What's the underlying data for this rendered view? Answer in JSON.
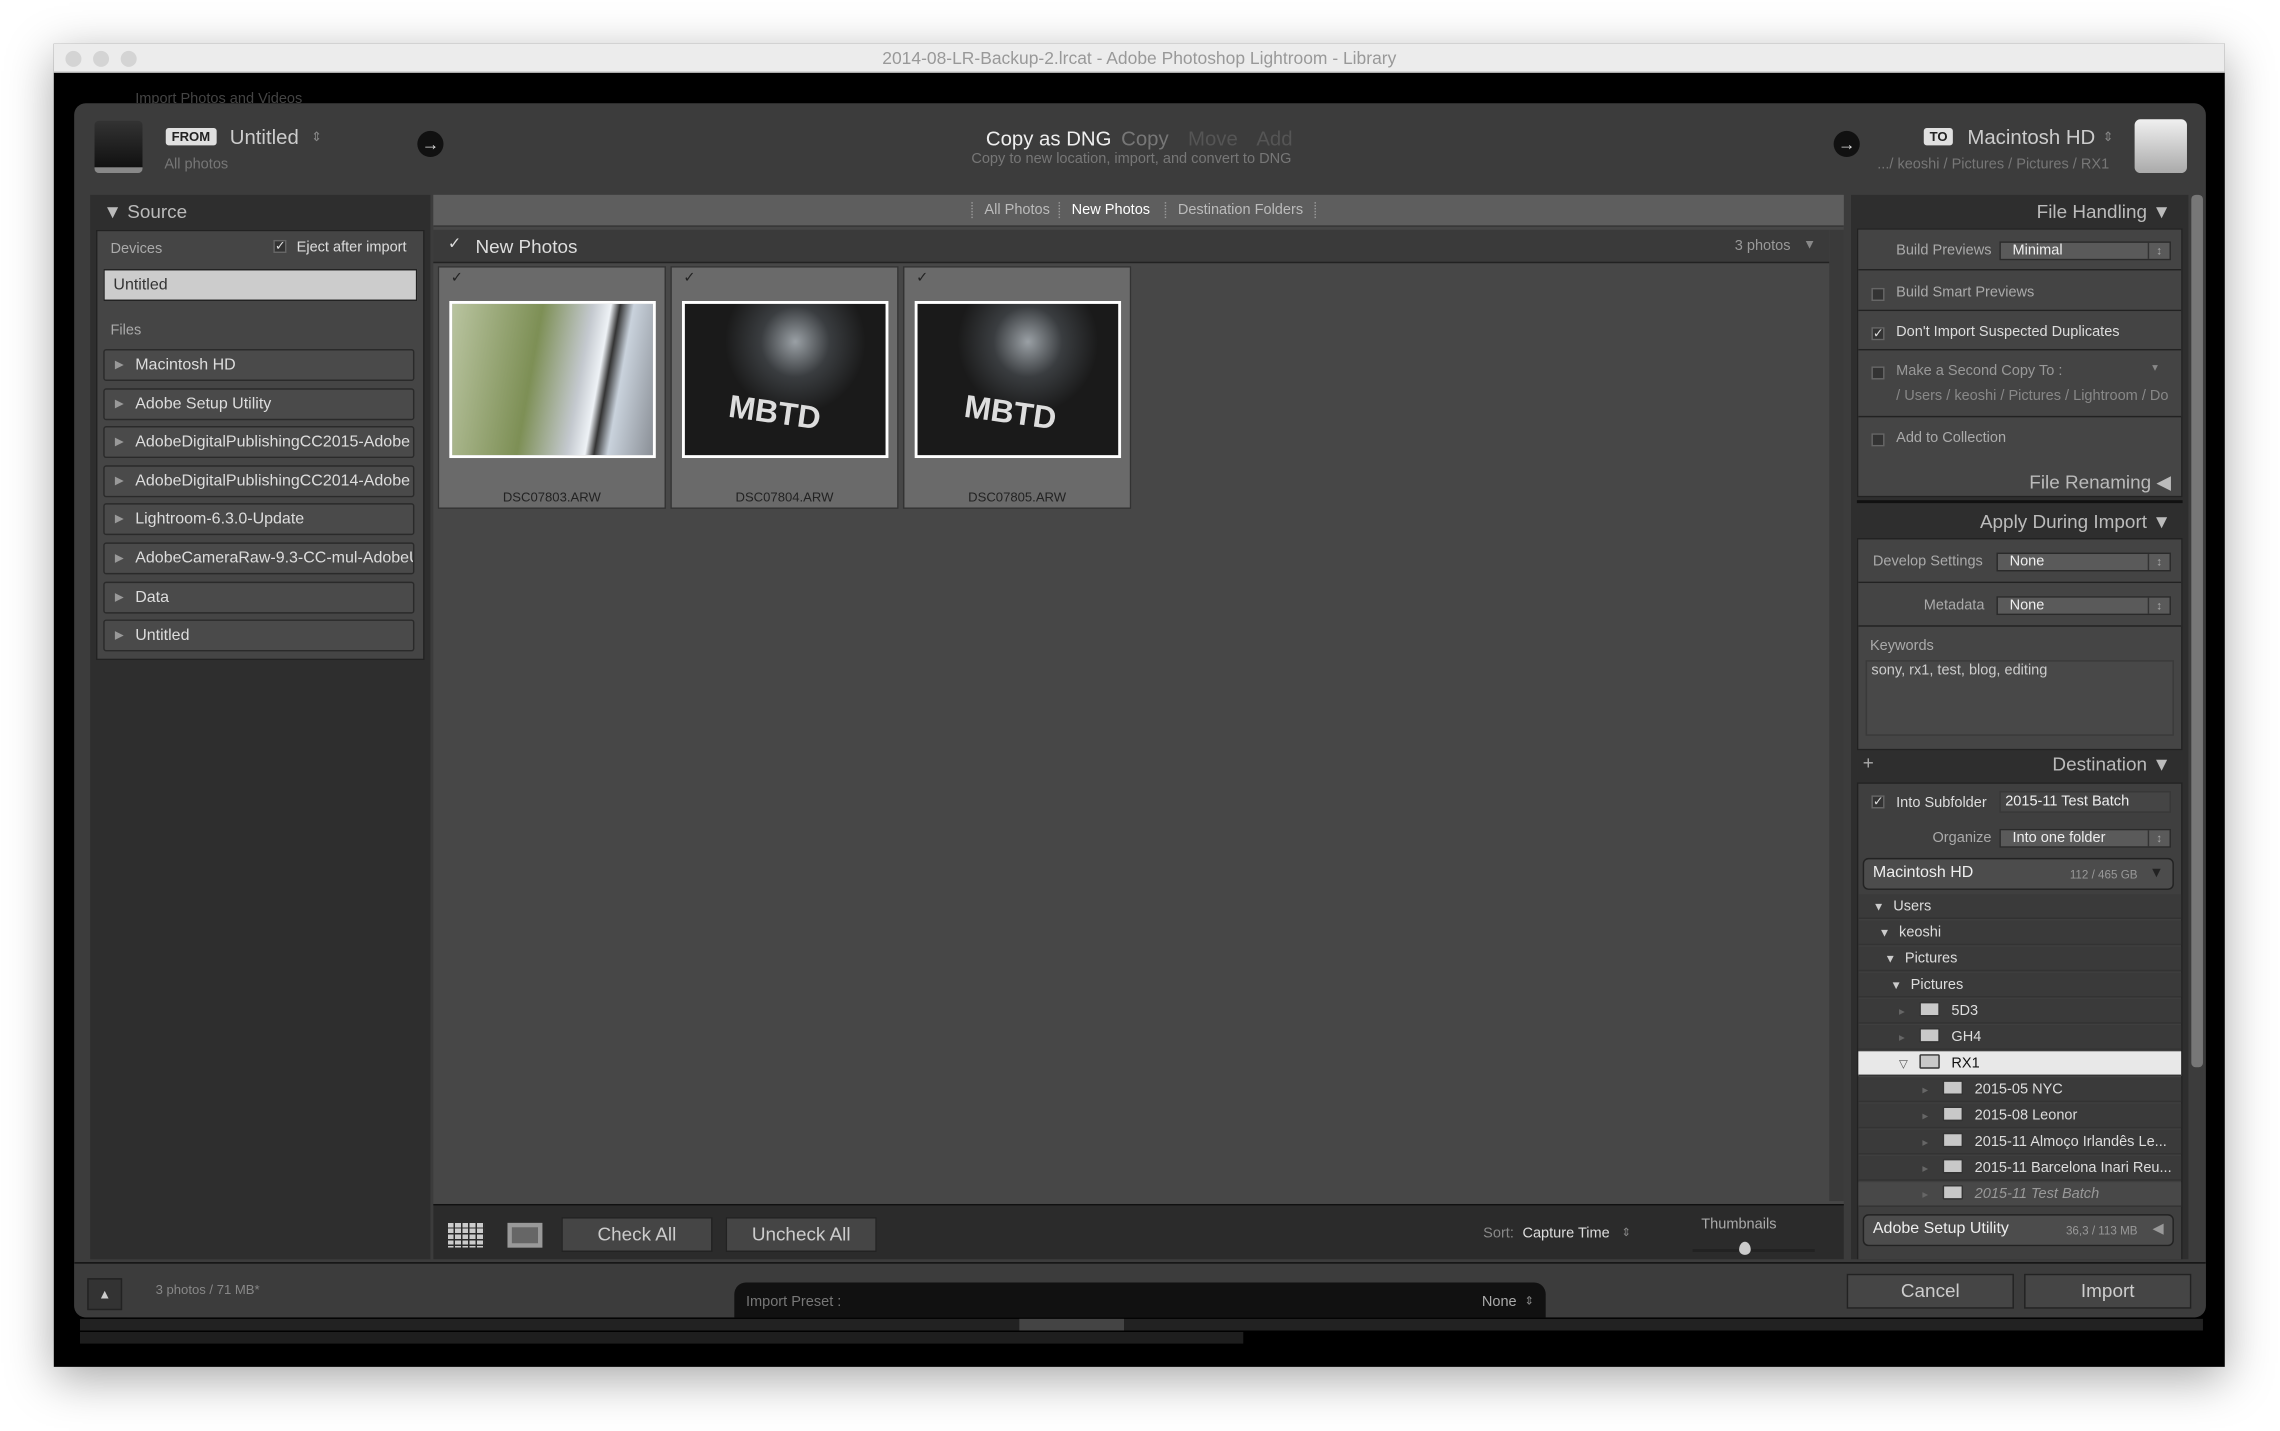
{
  "window": {
    "title": "2014-08-LR-Backup-2.lrcat - Adobe Photoshop Lightroom - Library",
    "behind_title": "Import Photos and Videos"
  },
  "header": {
    "from_badge": "FROM",
    "from_source": "Untitled",
    "from_sub": "All photos",
    "modes": [
      {
        "label": "Copy as DNG",
        "active": true
      },
      {
        "label": "Copy"
      },
      {
        "label": "Move"
      },
      {
        "label": "Add"
      }
    ],
    "mode_desc": "Copy to new location, import, and convert to DNG",
    "to_badge": "TO",
    "to_dest": "Macintosh HD",
    "to_path": ".../ keoshi / Pictures / Pictures / RX1"
  },
  "source": {
    "title": "Source",
    "devices_label": "Devices",
    "eject_label": "Eject after import",
    "eject_checked": true,
    "device": "Untitled",
    "files_label": "Files",
    "files": [
      "Macintosh HD",
      "Adobe Setup Utility",
      "AdobeDigitalPublishingCC2015-Adobe",
      "AdobeDigitalPublishingCC2014-Adobe",
      "Lightroom-6.3.0-Update",
      "AdobeCameraRaw-9.3-CC-mul-AdobeU",
      "Data",
      "Untitled"
    ]
  },
  "center": {
    "tabs": [
      "All Photos",
      "New Photos",
      "Destination Folders"
    ],
    "active_tab": "New Photos",
    "group_title": "New Photos",
    "count": "3 photos",
    "photos": [
      {
        "name": "DSC07803.ARW",
        "checked": true
      },
      {
        "name": "DSC07804.ARW",
        "checked": true
      },
      {
        "name": "DSC07805.ARW",
        "checked": true
      }
    ],
    "check_all": "Check All",
    "uncheck_all": "Uncheck All",
    "sort_label": "Sort:",
    "sort_value": "Capture Time",
    "thumbs_label": "Thumbnails"
  },
  "file_handling": {
    "title": "File Handling",
    "build_previews_label": "Build Previews",
    "build_previews": "Minimal",
    "smart_previews": "Build Smart Previews",
    "no_duplicates": "Don't Import Suspected Duplicates",
    "second_copy": "Make a Second Copy To :",
    "second_copy_path": "/ Users / keoshi / Pictures / Lightroom / Do",
    "add_collection": "Add to Collection"
  },
  "file_renaming": {
    "title": "File Renaming"
  },
  "apply": {
    "title": "Apply During Import",
    "develop_label": "Develop Settings",
    "develop": "None",
    "metadata_label": "Metadata",
    "metadata": "None",
    "keywords_label": "Keywords",
    "keywords": "sony, rx1, test, blog, editing"
  },
  "destination": {
    "title": "Destination",
    "subfolder_label": "Into Subfolder",
    "subfolder": "2015-11 Test Batch",
    "organize_label": "Organize",
    "organize": "Into one folder",
    "volume": "Macintosh HD",
    "volume_size": "112 / 465 GB",
    "tree": [
      "Users",
      "keoshi",
      "Pictures",
      "Pictures"
    ],
    "folders": [
      "5D3",
      "GH4",
      "RX1"
    ],
    "selected": "RX1",
    "subfolders": [
      "2015-05 NYC",
      "2015-08 Leonor",
      "2015-11 Almoço Irlandês Le...",
      "2015-11 Barcelona Inari Reu..."
    ],
    "new_folder": "2015-11 Test Batch",
    "volume2": "Adobe Setup Utility",
    "volume2_size": "36,3 / 113 MB"
  },
  "footer": {
    "summary": "3 photos / 71 MB*",
    "preset_label": "Import Preset :",
    "preset": "None",
    "cancel": "Cancel",
    "import": "Import"
  },
  "colors": {
    "panel": "#2e2e2e",
    "grid": "#474747",
    "selected_row": "#e8e8e8"
  }
}
